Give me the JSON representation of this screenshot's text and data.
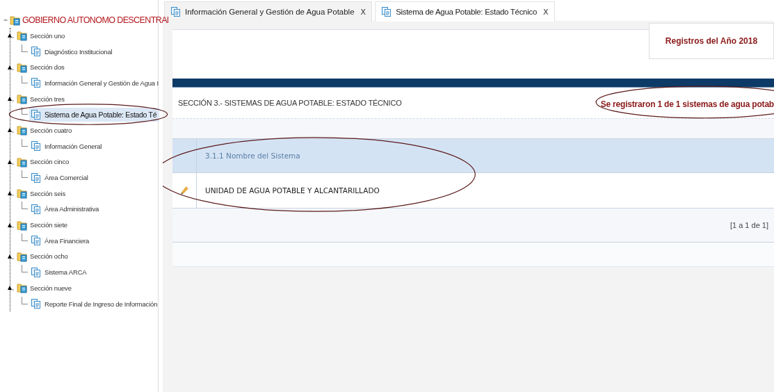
{
  "tree": {
    "label": "GOBIERNO AUTONOMO DESCENTRAl",
    "expanded": true,
    "children": [
      {
        "label": "Sección uno",
        "expanded": true,
        "children": [
          {
            "label": "Diagnóstico Institucional",
            "selected": false,
            "circled": false
          }
        ]
      },
      {
        "label": "Sección dos",
        "expanded": true,
        "children": [
          {
            "label": "Información General y Gestión de Agua I",
            "selected": false,
            "circled": false
          }
        ]
      },
      {
        "label": "Sección tres",
        "expanded": true,
        "children": [
          {
            "label": "Sistema de Agua Potable: Estado Té",
            "selected": true,
            "circled": true
          }
        ]
      },
      {
        "label": "Sección cuatro",
        "expanded": true,
        "children": [
          {
            "label": "Información General",
            "selected": false,
            "circled": false
          }
        ]
      },
      {
        "label": "Sección cinco",
        "expanded": true,
        "children": [
          {
            "label": "Área Comercial",
            "selected": false,
            "circled": false
          }
        ]
      },
      {
        "label": "Sección seis",
        "expanded": true,
        "children": [
          {
            "label": "Área Administrativa",
            "selected": false,
            "circled": false
          }
        ]
      },
      {
        "label": "Sección siete",
        "expanded": true,
        "children": [
          {
            "label": "Área Financiera",
            "selected": false,
            "circled": false
          }
        ]
      },
      {
        "label": "Sección ocho",
        "expanded": true,
        "children": [
          {
            "label": "Sistema ARCA",
            "selected": false,
            "circled": false
          }
        ]
      },
      {
        "label": "Sección nueve",
        "expanded": true,
        "children": [
          {
            "label": "Reporte Final de Ingreso de Información",
            "selected": false,
            "circled": false
          }
        ]
      }
    ]
  },
  "tabs": [
    {
      "label": "Información General y Gestión de Agua Potable",
      "close": "X",
      "selected": false
    },
    {
      "label": "Sistema de Agua Potable: Estado Técnico",
      "close": "X",
      "selected": true
    }
  ],
  "year_box": "Registros del Año 2018",
  "section": {
    "title": "SECCIÓN 3.- SISTEMAS DE AGUA POTABLE: ESTADO TÉCNICO",
    "status": "Se registraron 1 de 1 sistemas de agua potab",
    "status_circled": true
  },
  "table": {
    "circled": true,
    "columns": [
      "3.1.1 Nombre del Sistema"
    ],
    "rows": [
      {
        "cells": [
          "UNIDAD DE AGUA POTABLE Y ALCANTARILLADO"
        ]
      }
    ],
    "pager": "[1 a 1 de 1]"
  }
}
